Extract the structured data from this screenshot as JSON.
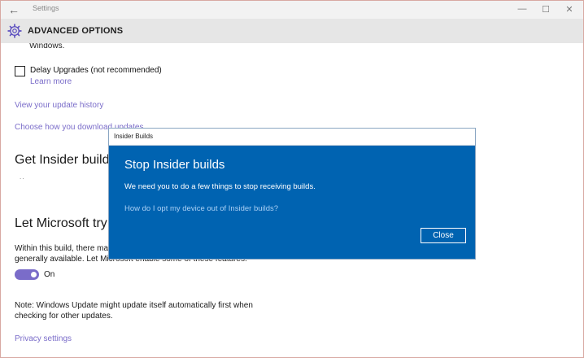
{
  "window": {
    "title": "Settings",
    "controls": {
      "minimize": "—",
      "maximize": "☐",
      "close": "✕"
    },
    "back_glyph": "←"
  },
  "header": {
    "title": "ADVANCED OPTIONS",
    "icon": "gear-icon"
  },
  "content": {
    "truncated_text": "Windows.",
    "delay_upgrades": {
      "label": "Delay Upgrades (not recommended)",
      "checked": false
    },
    "learn_more": "Learn more",
    "update_history_link": "View your update history",
    "download_link": "Choose how you download updates",
    "insider_heading": "Get Insider builds",
    "loading_dots": "..",
    "features_heading": "Let Microsoft try",
    "features_text_line1": "Within this build, there ma",
    "features_text_line2": "generally available. Let Microsoft enable some of these features.",
    "toggle": {
      "state": "On",
      "on": true
    },
    "note_text": "Note: Windows Update might update itself automatically first when checking for other updates.",
    "privacy_link": "Privacy settings"
  },
  "dialog": {
    "window_title": "Insider Builds",
    "heading": "Stop Insider builds",
    "message": "We need you to do a few things to stop receiving builds.",
    "link": "How do I opt my device out of Insider builds?",
    "close_button": "Close"
  },
  "colors": {
    "accent": "#7a6cc9",
    "dialog_bg": "#0063b1",
    "dialog_link": "#a9d0f5"
  }
}
